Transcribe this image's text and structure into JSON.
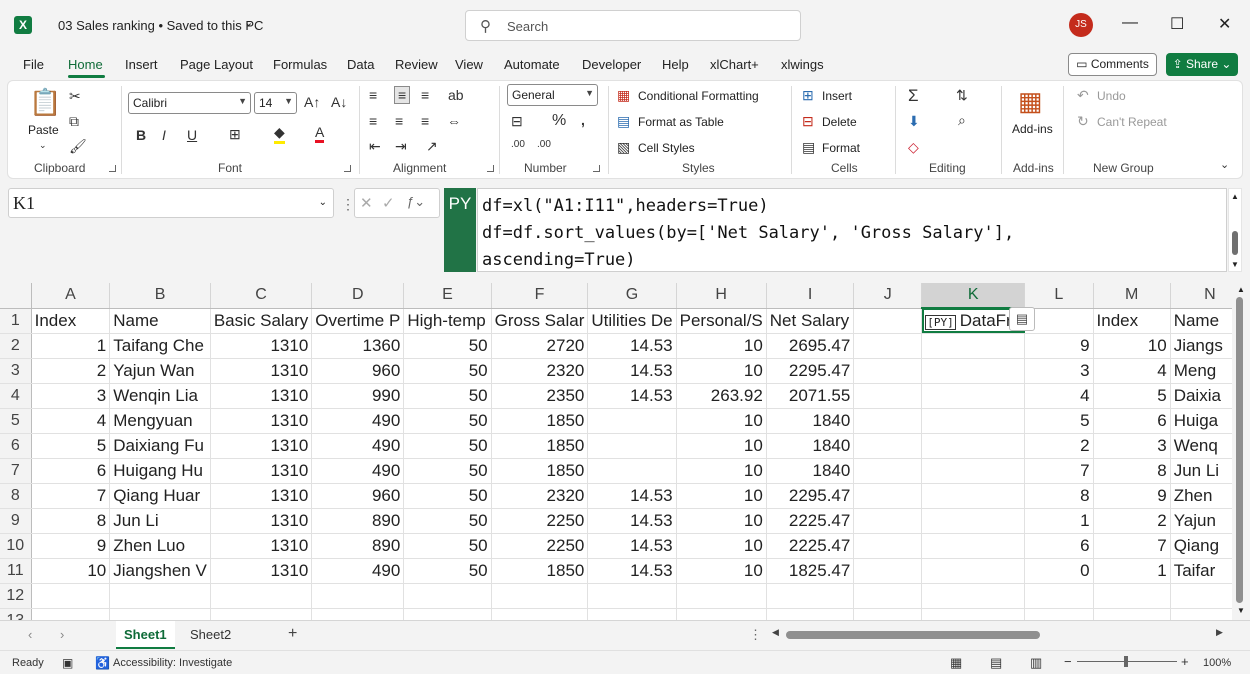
{
  "title_bar": {
    "app_letter": "X",
    "document_title": "03 Sales ranking  •  Saved to this PC",
    "search_placeholder": "Search",
    "user_initials": "JS"
  },
  "menu": {
    "tabs": [
      "File",
      "Home",
      "Insert",
      "Page Layout",
      "Formulas",
      "Data",
      "Review",
      "View",
      "Automate",
      "Developer",
      "Help",
      "xlChart+",
      "xlwings"
    ],
    "active_tab": "Home",
    "comments_label": "Comments",
    "share_label": "Share"
  },
  "ribbon": {
    "clipboard": {
      "label": "Clipboard",
      "paste": "Paste"
    },
    "font": {
      "label": "Font",
      "family": "Calibri",
      "size": "14"
    },
    "alignment": {
      "label": "Alignment"
    },
    "number": {
      "label": "Number",
      "format": "General"
    },
    "styles": {
      "label": "Styles",
      "conditional_formatting": "Conditional Formatting",
      "format_as_table": "Format as Table",
      "cell_styles": "Cell Styles"
    },
    "cells": {
      "label": "Cells",
      "insert": "Insert",
      "delete": "Delete",
      "format": "Format"
    },
    "editing": {
      "label": "Editing"
    },
    "addins": {
      "label": "Add-ins",
      "button": "Add-ins"
    },
    "new_group": {
      "label": "New Group",
      "undo": "Undo",
      "cant_repeat": "Can't Repeat"
    }
  },
  "formula_bar": {
    "name_box": "K1",
    "py_badge": "PY",
    "formula": "df=xl(\"A1:I11\",headers=True)\ndf=df.sort_values(by=['Net Salary', 'Gross Salary'],\nascending=True)"
  },
  "sheet": {
    "columns": [
      "A",
      "B",
      "C",
      "D",
      "E",
      "F",
      "G",
      "H",
      "I",
      "J",
      "K",
      "L",
      "M",
      "N"
    ],
    "selected_column": "K",
    "rows": [
      [
        "1",
        "Index",
        "Name",
        "Basic Salary",
        "Overtime P",
        "High-temp",
        "Gross Salar",
        "Utilities De",
        "Personal/S",
        "Net Salary",
        "",
        "DataFra",
        "",
        "Index",
        "Name"
      ],
      [
        "2",
        "1",
        "Taifang Che",
        "1310",
        "1360",
        "50",
        "2720",
        "14.53",
        "10",
        "2695.47",
        "",
        "",
        "9",
        "10",
        "Jiangs"
      ],
      [
        "3",
        "2",
        "Yajun Wan",
        "1310",
        "960",
        "50",
        "2320",
        "14.53",
        "10",
        "2295.47",
        "",
        "",
        "3",
        "4",
        "Meng"
      ],
      [
        "4",
        "3",
        "Wenqin Lia",
        "1310",
        "990",
        "50",
        "2350",
        "14.53",
        "263.92",
        "2071.55",
        "",
        "",
        "4",
        "5",
        "Daixia"
      ],
      [
        "5",
        "4",
        "Mengyuan",
        "1310",
        "490",
        "50",
        "1850",
        "",
        "10",
        "1840",
        "",
        "",
        "5",
        "6",
        "Huiga"
      ],
      [
        "6",
        "5",
        "Daixiang Fu",
        "1310",
        "490",
        "50",
        "1850",
        "",
        "10",
        "1840",
        "",
        "",
        "2",
        "3",
        "Wenq"
      ],
      [
        "7",
        "6",
        "Huigang Hu",
        "1310",
        "490",
        "50",
        "1850",
        "",
        "10",
        "1840",
        "",
        "",
        "7",
        "8",
        "Jun Li"
      ],
      [
        "8",
        "7",
        "Qiang Huar",
        "1310",
        "960",
        "50",
        "2320",
        "14.53",
        "10",
        "2295.47",
        "",
        "",
        "8",
        "9",
        "Zhen"
      ],
      [
        "9",
        "8",
        "Jun Li",
        "1310",
        "890",
        "50",
        "2250",
        "14.53",
        "10",
        "2225.47",
        "",
        "",
        "1",
        "2",
        "Yajun"
      ],
      [
        "10",
        "9",
        "Zhen Luo",
        "1310",
        "890",
        "50",
        "2250",
        "14.53",
        "10",
        "2225.47",
        "",
        "",
        "6",
        "7",
        "Qiang"
      ],
      [
        "11",
        "10",
        "Jiangshen V",
        "1310",
        "490",
        "50",
        "1850",
        "14.53",
        "10",
        "1825.47",
        "",
        "",
        "0",
        "1",
        "Taifar"
      ],
      [
        "12",
        "",
        "",
        "",
        "",
        "",
        "",
        "",
        "",
        "",
        "",
        "",
        "",
        "",
        ""
      ],
      [
        "13",
        "",
        "",
        "",
        "",
        "",
        "",
        "",
        "",
        "",
        "",
        "",
        "",
        "",
        ""
      ]
    ],
    "df_icon": "[PY]"
  },
  "sheet_tabs": {
    "tabs": [
      "Sheet1",
      "Sheet2"
    ],
    "active": "Sheet1",
    "add_label": "+"
  },
  "status_bar": {
    "ready": "Ready",
    "accessibility": "Accessibility: Investigate",
    "zoom": "100%"
  }
}
